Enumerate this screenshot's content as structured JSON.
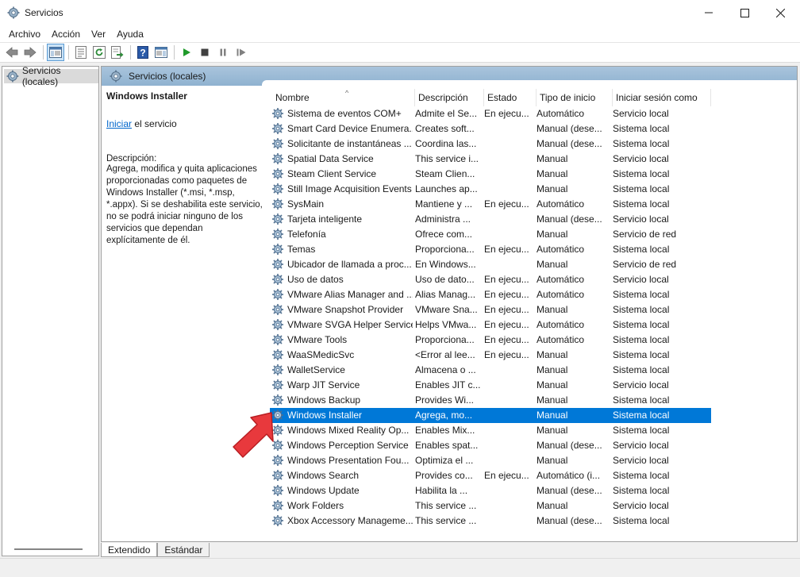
{
  "window": {
    "title": "Servicios"
  },
  "menu": [
    "Archivo",
    "Acción",
    "Ver",
    "Ayuda"
  ],
  "tree": {
    "root_label": "Servicios (locales)"
  },
  "content": {
    "header_label": "Servicios (locales)"
  },
  "details": {
    "service_name": "Windows Installer",
    "start_link": "Iniciar",
    "start_suffix": " el servicio",
    "description_label": "Descripción:",
    "description_lines": [
      "Agrega, modifica y quita aplicaciones",
      "proporcionadas como paquetes de",
      "Windows Installer (*.msi, *.msp,",
      "*.appx). Si se deshabilita este servicio,",
      "no se podrá iniciar ninguno de los",
      "servicios que dependan",
      "explícitamente de él."
    ]
  },
  "columns": [
    "Nombre",
    "Descripción",
    "Estado",
    "Tipo de inicio",
    "Iniciar sesión como"
  ],
  "rows": [
    [
      "Sistema de eventos COM+",
      "Admite el Se...",
      "En ejecu...",
      "Automático",
      "Servicio local"
    ],
    [
      "Smart Card Device Enumera...",
      "Creates soft...",
      "",
      "Manual (dese...",
      "Sistema local"
    ],
    [
      "Solicitante de instantáneas ...",
      "Coordina las...",
      "",
      "Manual (dese...",
      "Sistema local"
    ],
    [
      "Spatial Data Service",
      "This service i...",
      "",
      "Manual",
      "Servicio local"
    ],
    [
      "Steam Client Service",
      "Steam Clien...",
      "",
      "Manual",
      "Sistema local"
    ],
    [
      "Still Image Acquisition Events",
      "Launches ap...",
      "",
      "Manual",
      "Sistema local"
    ],
    [
      "SysMain",
      "Mantiene y ...",
      "En ejecu...",
      "Automático",
      "Sistema local"
    ],
    [
      "Tarjeta inteligente",
      "Administra ...",
      "",
      "Manual (dese...",
      "Servicio local"
    ],
    [
      "Telefonía",
      "Ofrece com...",
      "",
      "Manual",
      "Servicio de red"
    ],
    [
      "Temas",
      "Proporciona...",
      "En ejecu...",
      "Automático",
      "Sistema local"
    ],
    [
      "Ubicador de llamada a proc...",
      "En Windows...",
      "",
      "Manual",
      "Servicio de red"
    ],
    [
      "Uso de datos",
      "Uso de dato...",
      "En ejecu...",
      "Automático",
      "Servicio local"
    ],
    [
      "VMware Alias Manager and ...",
      "Alias Manag...",
      "En ejecu...",
      "Automático",
      "Sistema local"
    ],
    [
      "VMware Snapshot Provider",
      "VMware Sna...",
      "En ejecu...",
      "Manual",
      "Sistema local"
    ],
    [
      "VMware SVGA Helper Service",
      "Helps VMwa...",
      "En ejecu...",
      "Automático",
      "Sistema local"
    ],
    [
      "VMware Tools",
      "Proporciona...",
      "En ejecu...",
      "Automático",
      "Sistema local"
    ],
    [
      "WaaSMedicSvc",
      "<Error al lee...",
      "En ejecu...",
      "Manual",
      "Sistema local"
    ],
    [
      "WalletService",
      "Almacena o ...",
      "",
      "Manual",
      "Sistema local"
    ],
    [
      "Warp JIT Service",
      "Enables JIT c...",
      "",
      "Manual",
      "Servicio local"
    ],
    [
      "Windows Backup",
      "Provides Wi...",
      "",
      "Manual",
      "Sistema local"
    ],
    [
      "Windows Installer",
      "Agrega, mo...",
      "",
      "Manual",
      "Sistema local"
    ],
    [
      "Windows Mixed Reality Op...",
      "Enables Mix...",
      "",
      "Manual",
      "Sistema local"
    ],
    [
      "Windows Perception Service",
      "Enables spat...",
      "",
      "Manual (dese...",
      "Servicio local"
    ],
    [
      "Windows Presentation Fou...",
      "Optimiza el ...",
      "",
      "Manual",
      "Servicio local"
    ],
    [
      "Windows Search",
      "Provides co...",
      "En ejecu...",
      "Automático (i...",
      "Sistema local"
    ],
    [
      "Windows Update",
      "Habilita la ...",
      "",
      "Manual (dese...",
      "Sistema local"
    ],
    [
      "Work Folders",
      "This service ...",
      "",
      "Manual",
      "Servicio local"
    ],
    [
      "Xbox Accessory Manageme...",
      "This service ...",
      "",
      "Manual (dese...",
      "Sistema local"
    ]
  ],
  "selected_row": 20,
  "tabs": [
    "Extendido",
    "Estándar"
  ],
  "active_tab": 0,
  "colors": {
    "selection": "#0078d7",
    "header_band": "#9fbcd6",
    "link": "#0066cc",
    "annotation_arrow": "#e8393d"
  },
  "icons": [
    "services-app-icon",
    "minimize-icon",
    "maximize-icon",
    "close-icon",
    "back-icon",
    "forward-icon",
    "console-tree-icon",
    "properties-icon",
    "refresh-icon",
    "export-icon",
    "help-icon",
    "action-pane-icon",
    "start-icon",
    "stop-icon",
    "pause-icon",
    "resume-icon",
    "service-gear-icon",
    "annotation-arrow"
  ]
}
